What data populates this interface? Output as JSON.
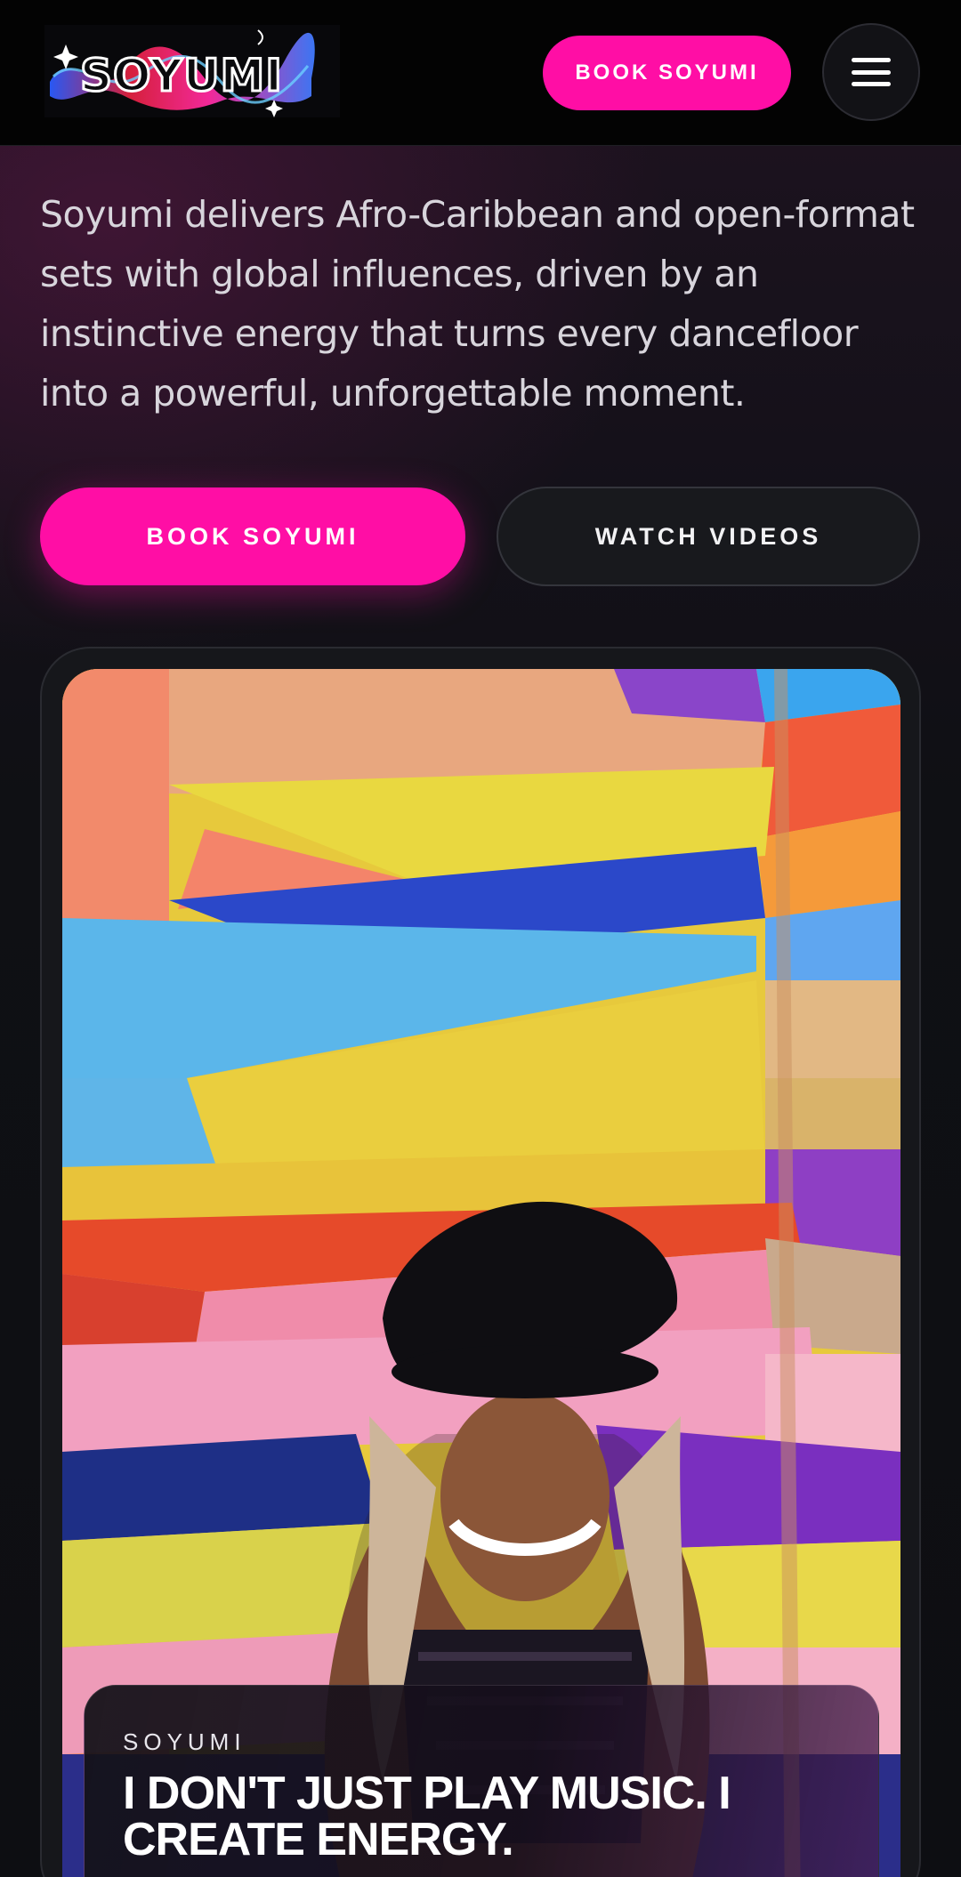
{
  "header": {
    "logo_text": "SOYUMI",
    "book_label": "BOOK SOYUMI",
    "menu_icon": "hamburger-menu-icon"
  },
  "intro": {
    "text": "Soyumi delivers Afro-Caribbean and open-format sets with global influences, driven by an instinctive energy that turns every dancefloor into a powerful, unforgettable moment."
  },
  "cta": {
    "book_label": "BOOK SOYUMI",
    "watch_label": "WATCH VIDEOS"
  },
  "feature": {
    "eyebrow": "SOYUMI",
    "headline": "I DON'T JUST PLAY MUSIC. I CREATE ENERGY."
  },
  "colors": {
    "accent": "#ff0ea5",
    "background": "#0d0e12",
    "header": "#030303"
  }
}
